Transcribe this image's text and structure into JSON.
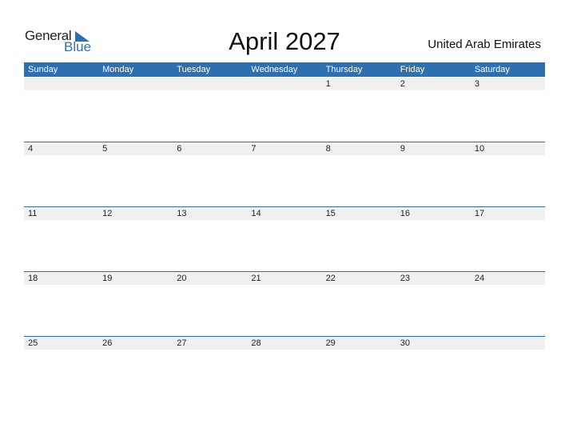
{
  "logo": {
    "word1": "General",
    "word2": "Blue"
  },
  "title": "April 2027",
  "country": "United Arab Emirates",
  "weekdays": [
    "Sunday",
    "Monday",
    "Tuesday",
    "Wednesday",
    "Thursday",
    "Friday",
    "Saturday"
  ],
  "weeks": [
    [
      "",
      "",
      "",
      "",
      "1",
      "2",
      "3"
    ],
    [
      "4",
      "5",
      "6",
      "7",
      "8",
      "9",
      "10"
    ],
    [
      "11",
      "12",
      "13",
      "14",
      "15",
      "16",
      "17"
    ],
    [
      "18",
      "19",
      "20",
      "21",
      "22",
      "23",
      "24"
    ],
    [
      "25",
      "26",
      "27",
      "28",
      "29",
      "30",
      ""
    ]
  ],
  "colors": {
    "accent": "#2e6faf",
    "band": "#f0f0f0"
  }
}
